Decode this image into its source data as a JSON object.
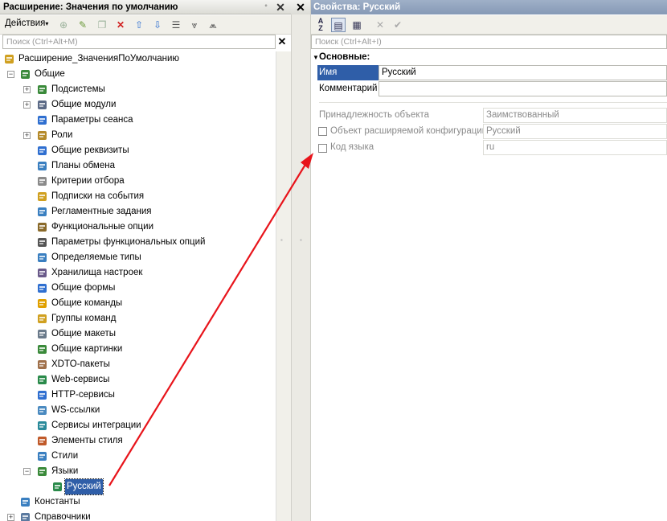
{
  "left_panel": {
    "title": "Расширение: Значения по умолчанию",
    "actions_label": "Действия",
    "search_placeholder": "Поиск (Ctrl+Alt+M)"
  },
  "tree": {
    "root": "Расширение_ЗначенияПоУмолчанию",
    "common": "Общие",
    "items": [
      "Подсистемы",
      "Общие модули",
      "Параметры сеанса",
      "Роли",
      "Общие реквизиты",
      "Планы обмена",
      "Критерии отбора",
      "Подписки на события",
      "Регламентные задания",
      "Функциональные опции",
      "Параметры функциональных опций",
      "Определяемые типы",
      "Хранилища настроек",
      "Общие формы",
      "Общие команды",
      "Группы команд",
      "Общие макеты",
      "Общие картинки",
      "XDTO-пакеты",
      "Web-сервисы",
      "HTTP-сервисы",
      "WS-ссылки",
      "Сервисы интеграции",
      "Элементы стиля",
      "Стили",
      "Языки"
    ],
    "selected": "Русский",
    "after": [
      "Константы",
      "Справочники"
    ]
  },
  "right_panel": {
    "title": "Свойства: Русский",
    "search_placeholder": "Поиск (Ctrl+Alt+I)",
    "section": "Основные:",
    "name_label": "Имя",
    "name_value": "Русский",
    "comment_label": "Комментарий",
    "comment_value": "",
    "belonging_label": "Принадлежность объекта",
    "belonging_value": "Заимствованный",
    "ext_object_label": "Объект расширяемой конфигурации",
    "ext_object_value": "Русский",
    "lang_code_label": "Код языка",
    "lang_code_value": "ru"
  },
  "colors": {
    "selection": "#2f5ea8",
    "arrow": "#e8141b",
    "properties_title": "#8fa2bf"
  }
}
